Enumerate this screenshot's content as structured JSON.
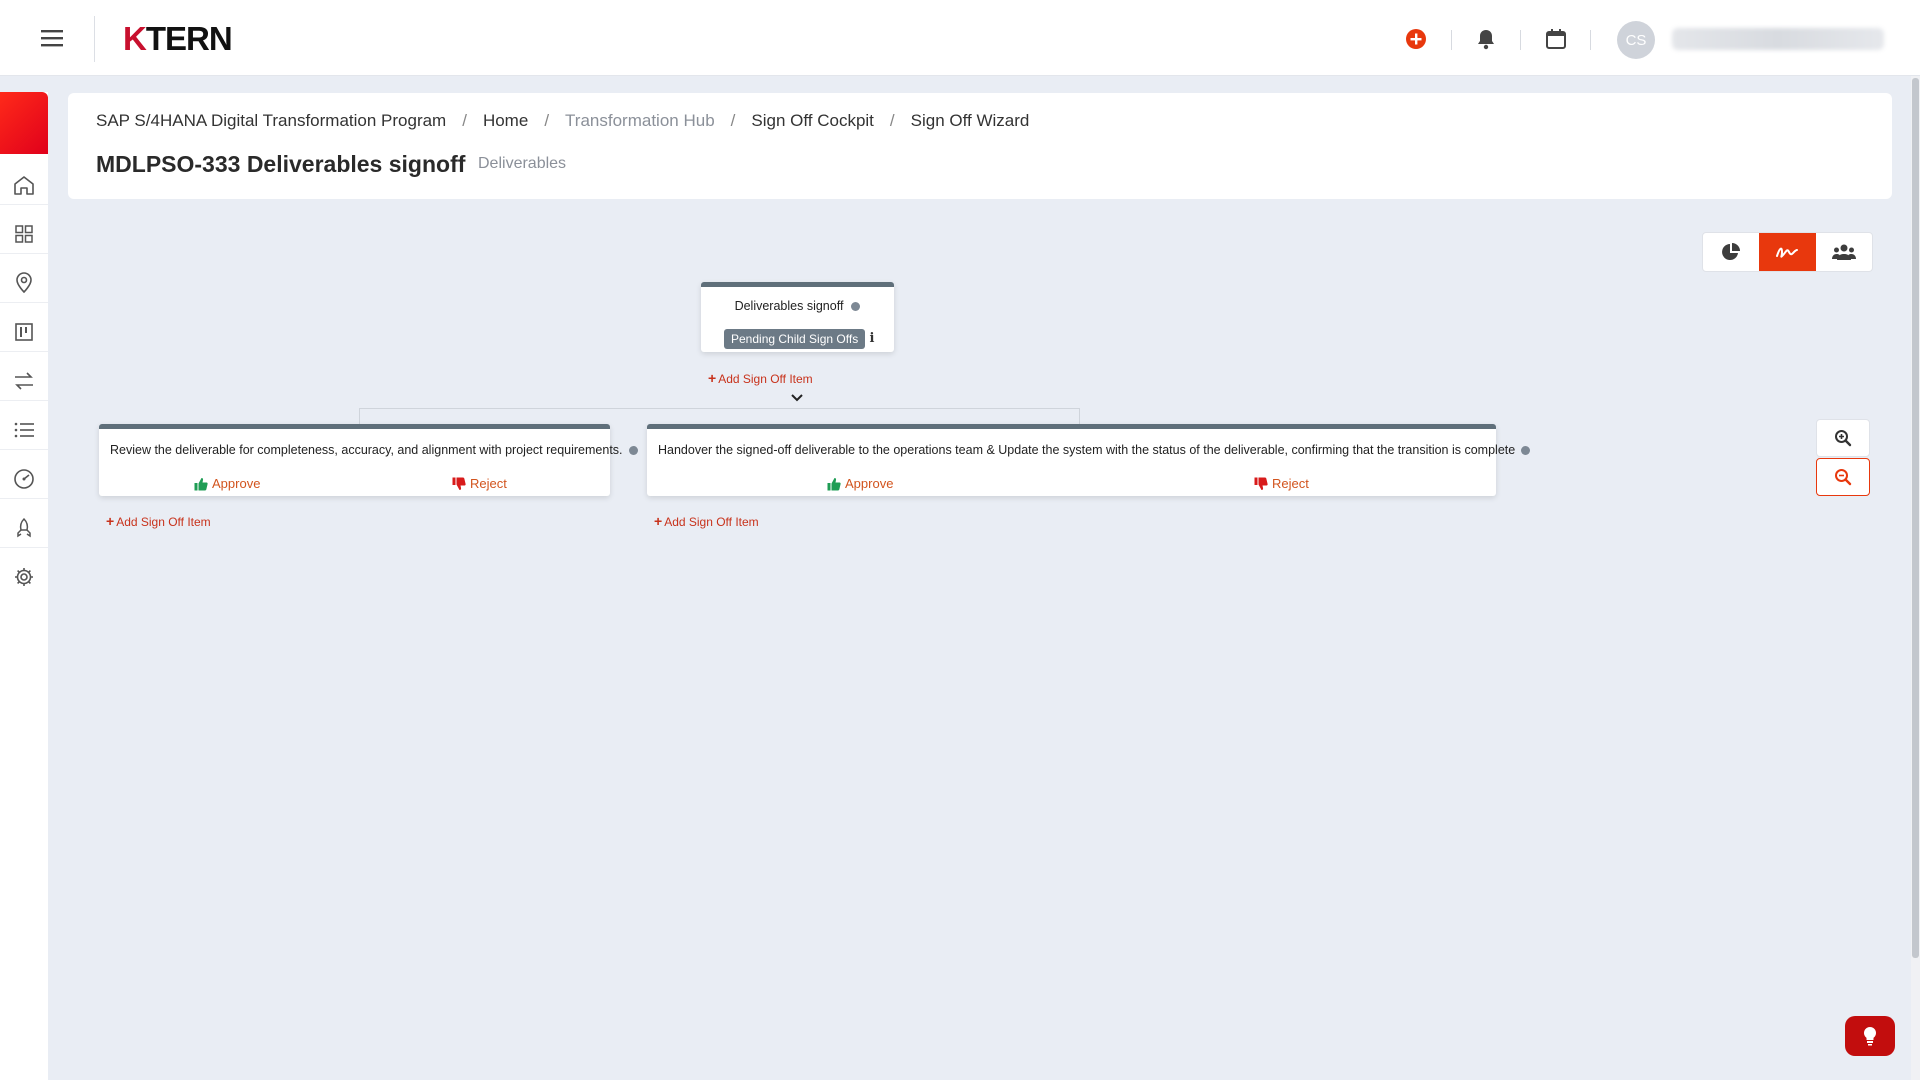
{
  "app": {
    "logo_prefix": "K",
    "logo_rest": "TERN",
    "avatar_initials": "CS"
  },
  "topbar": {
    "icons": [
      "hamburger-icon",
      "add-circle-icon",
      "bell-icon",
      "calendar-icon"
    ]
  },
  "sidebar": {
    "items": [
      "home-icon",
      "grid-icon",
      "location-pin-icon",
      "kanban-icon",
      "transfer-icon",
      "list-icon",
      "dashboard-gauge-icon",
      "rocket-icon",
      "gear-icon"
    ]
  },
  "breadcrumb": {
    "items": [
      {
        "label": "SAP S/4HANA Digital Transformation Program",
        "muted": false
      },
      {
        "label": "Home",
        "muted": false
      },
      {
        "label": "Transformation Hub",
        "muted": true
      },
      {
        "label": "Sign Off Cockpit",
        "muted": false
      },
      {
        "label": "Sign Off Wizard",
        "muted": false
      }
    ],
    "separator": "/"
  },
  "page": {
    "title": "MDLPSO-333 Deliverables signoff",
    "subtitle": "Deliverables"
  },
  "view_toggle": {
    "options": [
      "pie-chart-icon",
      "signature-icon",
      "users-icon"
    ],
    "active": "signature-icon"
  },
  "zoom": {
    "in_icon": "zoom-in-icon",
    "out_icon": "zoom-out-icon"
  },
  "tree": {
    "root": {
      "title": "Deliverables signoff",
      "status": "Pending Child Sign Offs",
      "info": "i",
      "add_label": "Add Sign Off Item"
    },
    "children": [
      {
        "text": "Review the deliverable for completeness, accuracy, and alignment with project requirements.",
        "approve_label": "Approve",
        "reject_label": "Reject",
        "add_label": "Add Sign Off Item"
      },
      {
        "text": "Handover the signed-off deliverable to the operations team & Update the system with the status of the deliverable, confirming that the transition is complete",
        "approve_label": "Approve",
        "reject_label": "Reject",
        "add_label": "Add Sign Off Item"
      }
    ]
  },
  "colors": {
    "accent": "#e8380d",
    "brand_red": "#c8102e",
    "node_border": "#5f6f7a",
    "approve": "#d2541e",
    "thumb_up": "#1f9d55",
    "thumb_down": "#d81b1b"
  }
}
